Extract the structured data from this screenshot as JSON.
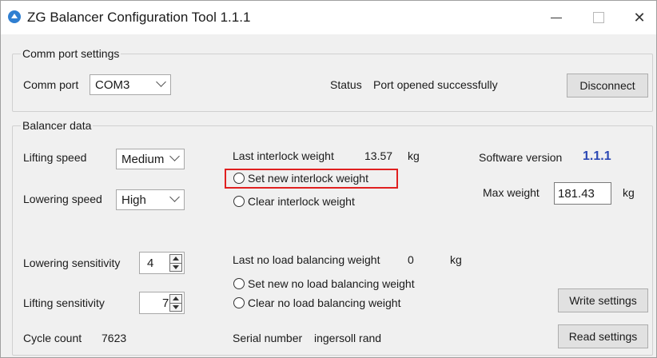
{
  "window": {
    "title": "ZG Balancer Configuration Tool 1.1.1",
    "close_glyph": "✕"
  },
  "comm": {
    "group_label": "Comm port settings",
    "port_label": "Comm port",
    "port_value": "COM3",
    "status_label": "Status",
    "status_value": "Port opened successfully",
    "disconnect_label": "Disconnect"
  },
  "balancer": {
    "group_label": "Balancer data",
    "lifting_speed_label": "Lifting speed",
    "lifting_speed_value": "Medium",
    "lowering_speed_label": "Lowering speed",
    "lowering_speed_value": "High",
    "last_interlock_label": "Last interlock weight",
    "last_interlock_value": "13.57",
    "last_interlock_unit": "kg",
    "set_interlock_label": "Set new interlock weight",
    "clear_interlock_label": "Clear interlock weight",
    "software_version_label": "Software version",
    "software_version_value": "1.1.1",
    "max_weight_label": "Max weight",
    "max_weight_value": "181.43",
    "max_weight_unit": "kg",
    "lowering_sensitivity_label": "Lowering sensitivity",
    "lowering_sensitivity_value": "4",
    "lifting_sensitivity_label": "Lifting sensitivity",
    "lifting_sensitivity_value": "7",
    "last_noload_label": "Last no load balancing weight",
    "last_noload_value": "0",
    "last_noload_unit": "kg",
    "set_noload_label": "Set new no load balancing weight",
    "clear_noload_label": "Clear no load balancing weight",
    "write_settings_label": "Write settings",
    "read_settings_label": "Read settings",
    "cycle_count_label": "Cycle count",
    "cycle_count_value": "7623",
    "serial_number_label": "Serial number",
    "serial_number_value": "ingersoll rand"
  },
  "colors": {
    "accent_version": "#2b48b4",
    "highlight_box": "#e02020"
  }
}
